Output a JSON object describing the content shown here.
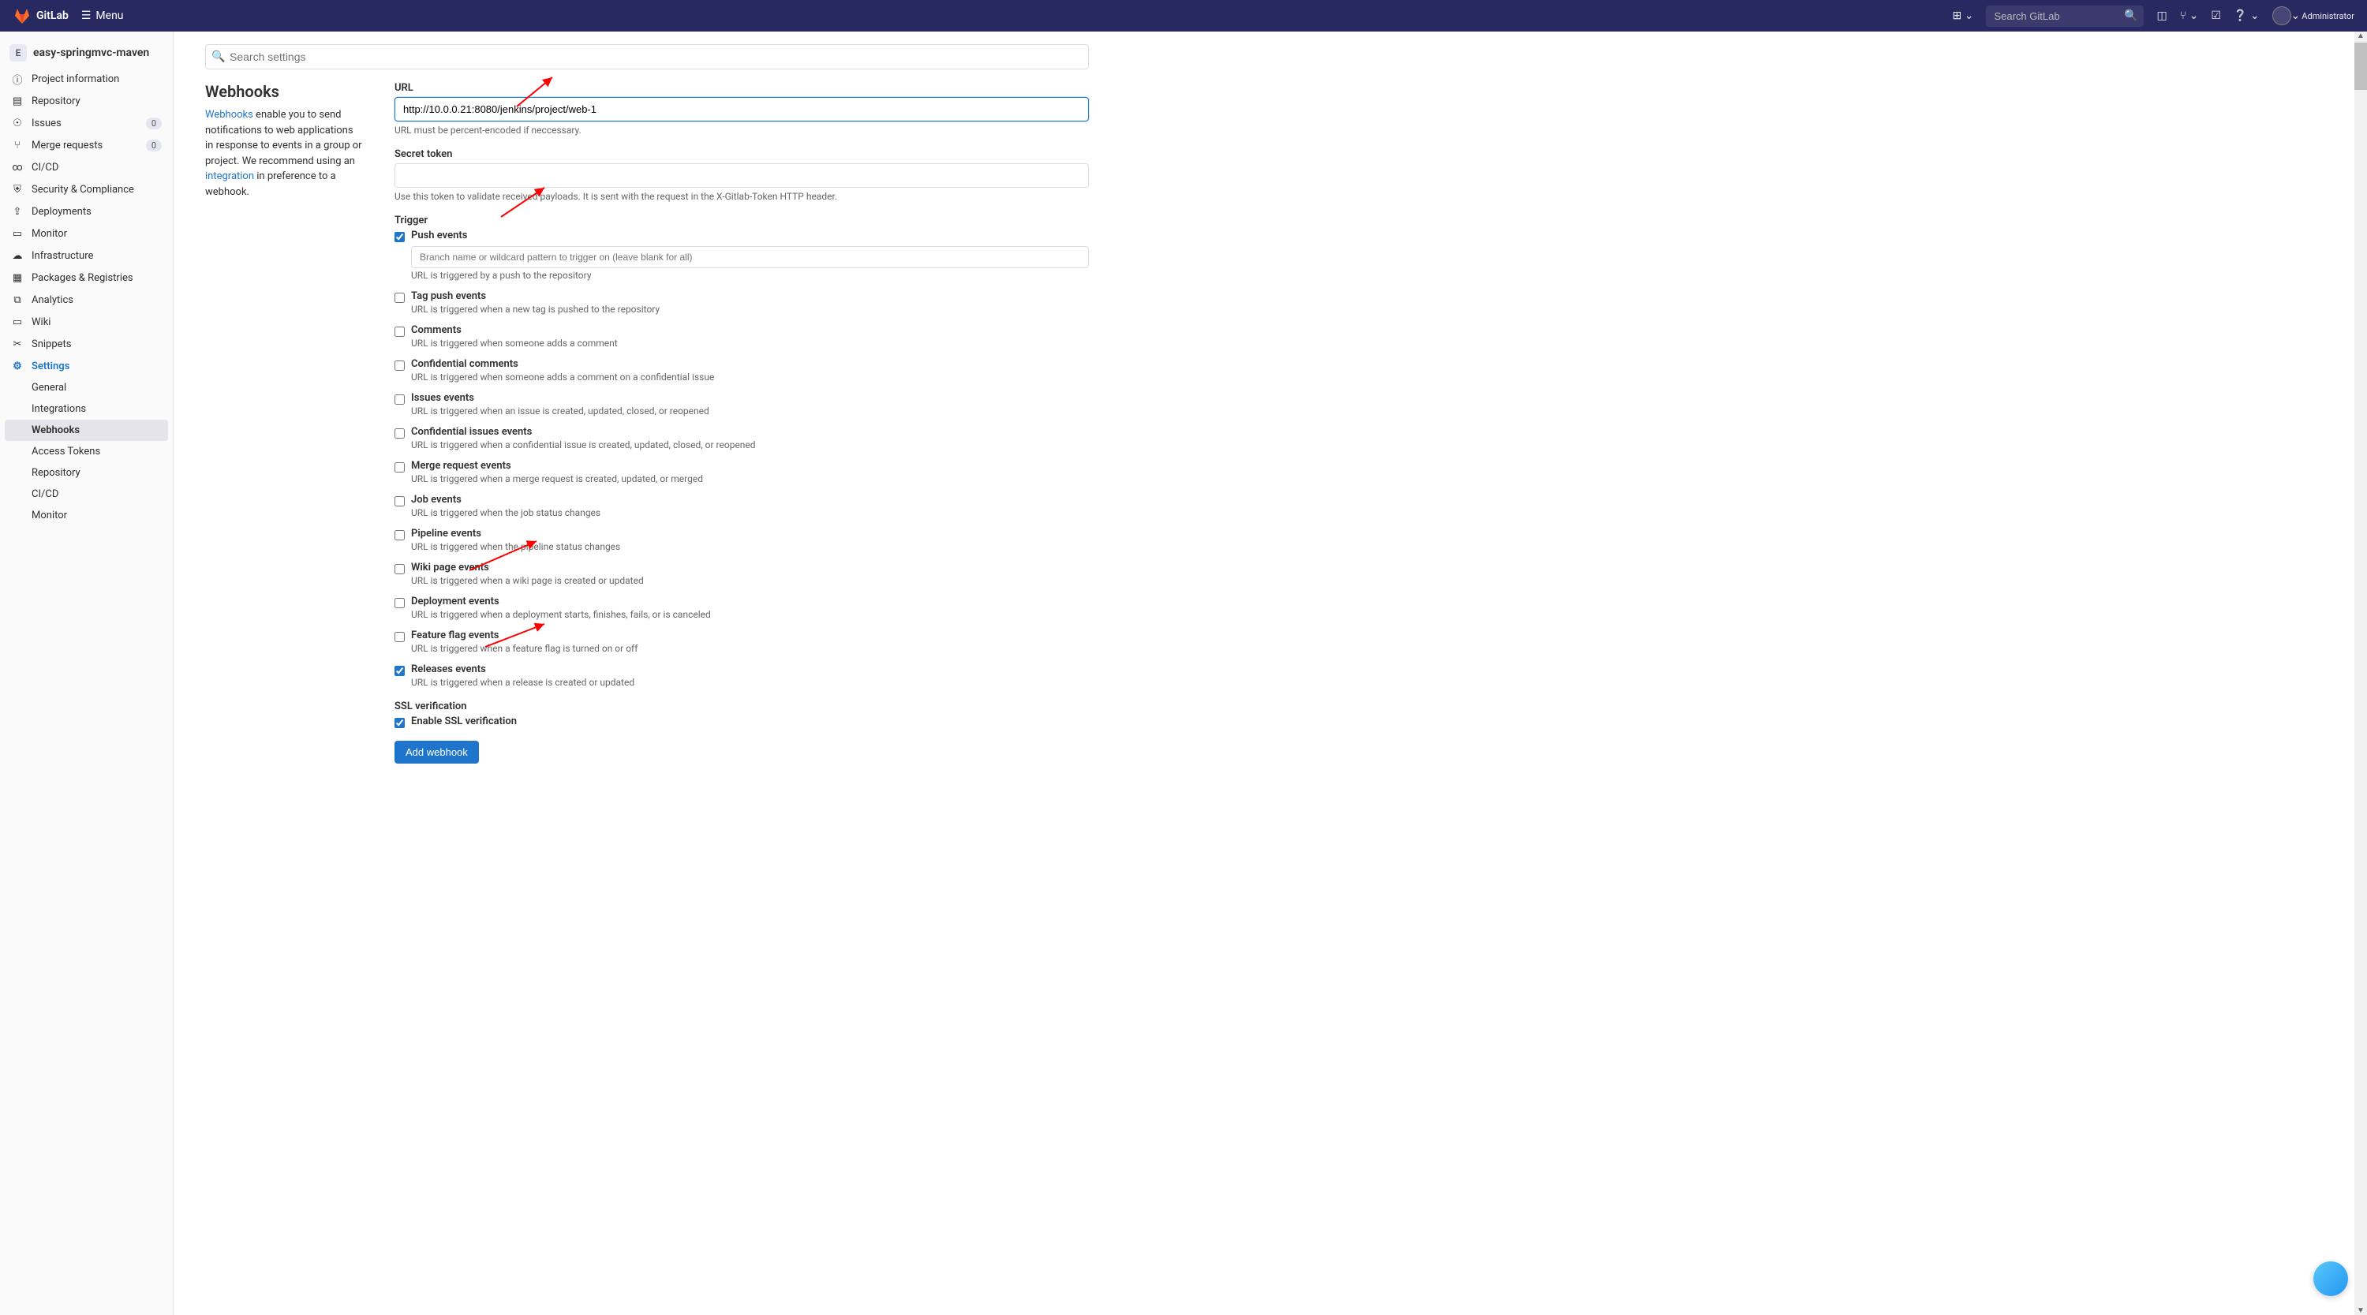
{
  "topnav": {
    "brand": "GitLab",
    "menu_label": "Menu",
    "search_placeholder": "Search GitLab",
    "admin_label": "Administrator"
  },
  "sidebar": {
    "project_initial": "E",
    "project_name": "easy-springmvc-maven",
    "items": [
      {
        "label": "Project information"
      },
      {
        "label": "Repository"
      },
      {
        "label": "Issues",
        "badge": "0"
      },
      {
        "label": "Merge requests",
        "badge": "0"
      },
      {
        "label": "CI/CD"
      },
      {
        "label": "Security & Compliance"
      },
      {
        "label": "Deployments"
      },
      {
        "label": "Monitor"
      },
      {
        "label": "Infrastructure"
      },
      {
        "label": "Packages & Registries"
      },
      {
        "label": "Analytics"
      },
      {
        "label": "Wiki"
      },
      {
        "label": "Snippets"
      },
      {
        "label": "Settings"
      }
    ],
    "sub_items": [
      {
        "label": "General"
      },
      {
        "label": "Integrations"
      },
      {
        "label": "Webhooks"
      },
      {
        "label": "Access Tokens"
      },
      {
        "label": "Repository"
      },
      {
        "label": "CI/CD"
      },
      {
        "label": "Monitor"
      }
    ]
  },
  "settings_search_placeholder": "Search settings",
  "webhooks": {
    "title": "Webhooks",
    "desc_link1": "Webhooks",
    "desc_text1": " enable you to send notifications to web applications in response to events in a group or project. We recommend using an ",
    "desc_link2": "integration",
    "desc_text2": " in preference to a webhook.",
    "url_label": "URL",
    "url_value": "http://10.0.0.21:8080/jenkins/project/web-1",
    "url_help": "URL must be percent-encoded if neccessary.",
    "secret_label": "Secret token",
    "secret_help": "Use this token to validate received payloads. It is sent with the request in the X-Gitlab-Token HTTP header.",
    "trigger_label": "Trigger",
    "triggers": [
      {
        "label": "Push events",
        "desc": "URL is triggered by a push to the repository",
        "checked": true,
        "has_pattern": true,
        "pattern_placeholder": "Branch name or wildcard pattern to trigger on (leave blank for all)"
      },
      {
        "label": "Tag push events",
        "desc": "URL is triggered when a new tag is pushed to the repository",
        "checked": false
      },
      {
        "label": "Comments",
        "desc": "URL is triggered when someone adds a comment",
        "checked": false
      },
      {
        "label": "Confidential comments",
        "desc": "URL is triggered when someone adds a comment on a confidential issue",
        "checked": false
      },
      {
        "label": "Issues events",
        "desc": "URL is triggered when an issue is created, updated, closed, or reopened",
        "checked": false
      },
      {
        "label": "Confidential issues events",
        "desc": "URL is triggered when a confidential issue is created, updated, closed, or reopened",
        "checked": false
      },
      {
        "label": "Merge request events",
        "desc": "URL is triggered when a merge request is created, updated, or merged",
        "checked": false
      },
      {
        "label": "Job events",
        "desc": "URL is triggered when the job status changes",
        "checked": false
      },
      {
        "label": "Pipeline events",
        "desc": "URL is triggered when the pipeline status changes",
        "checked": false
      },
      {
        "label": "Wiki page events",
        "desc": "URL is triggered when a wiki page is created or updated",
        "checked": false
      },
      {
        "label": "Deployment events",
        "desc": "URL is triggered when a deployment starts, finishes, fails, or is canceled",
        "checked": false
      },
      {
        "label": "Feature flag events",
        "desc": "URL is triggered when a feature flag is turned on or off",
        "checked": false
      },
      {
        "label": "Releases events",
        "desc": "URL is triggered when a release is created or updated",
        "checked": true
      }
    ],
    "ssl_label": "SSL verification",
    "ssl_checkbox_label": "Enable SSL verification",
    "ssl_checked": true,
    "add_button": "Add webhook"
  }
}
